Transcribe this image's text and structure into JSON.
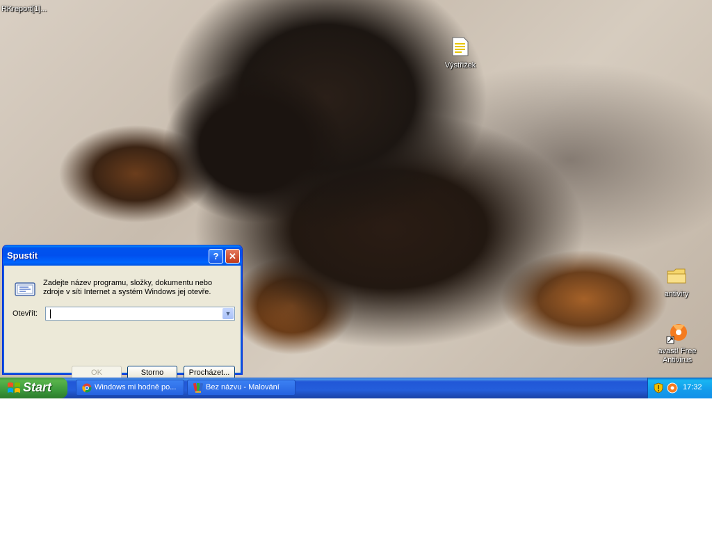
{
  "desktop": {
    "top_left_item": "RKreport[1]...",
    "icons": [
      {
        "label": "Výstřižek"
      },
      {
        "label": "antiviry"
      },
      {
        "label": "avast! Free Antivirus"
      }
    ]
  },
  "run_dialog": {
    "title": "Spustit",
    "help_glyph": "?",
    "close_glyph": "✕",
    "description": "Zadejte název programu, složky, dokumentu nebo zdroje v síti Internet a systém Windows jej otevře.",
    "open_label": "Otevřít:",
    "open_value": "",
    "ok_label": "OK",
    "cancel_label": "Storno",
    "browse_label": "Procházet..."
  },
  "taskbar": {
    "start_label": "Start",
    "tasks": [
      {
        "label": "Windows mi hodně po...",
        "icon": "chrome-icon"
      },
      {
        "label": "Bez názvu - Malování",
        "icon": "paint-icon"
      }
    ],
    "clock": "17:32"
  }
}
